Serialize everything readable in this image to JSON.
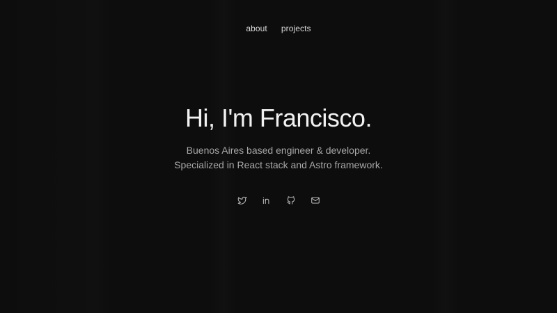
{
  "nav": {
    "items": [
      {
        "label": "about"
      },
      {
        "label": "projects"
      }
    ]
  },
  "hero": {
    "title": "Hi, I'm Francisco.",
    "subtitle_line1": "Buenos Aires based engineer & developer.",
    "subtitle_line2": "Specialized in React stack and Astro framework."
  },
  "socials": {
    "icons": [
      "twitter-icon",
      "linkedin-icon",
      "github-icon",
      "mail-icon"
    ]
  },
  "colors": {
    "background": "#0d0d0d",
    "title": "#f2f2f2",
    "subtitle": "#a8a8a8",
    "icon": "#cfcfcf"
  }
}
